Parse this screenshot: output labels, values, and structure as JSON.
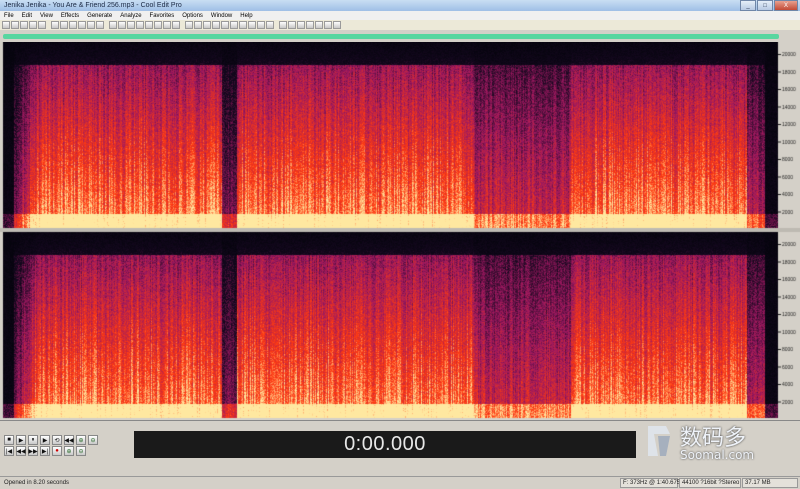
{
  "window": {
    "title": "Jenika Jenika - You Are & Friend 256.mp3 - Cool Edit Pro",
    "minimize": "_",
    "maximize": "□",
    "close": "X"
  },
  "menu": [
    "File",
    "Edit",
    "View",
    "Effects",
    "Generate",
    "Analyze",
    "Favorites",
    "Options",
    "Window",
    "Help"
  ],
  "time_display": "0:00.000",
  "transport": {
    "row1": [
      "■",
      "▶",
      "⏸",
      "▶",
      "⟲",
      "◀◀"
    ],
    "row2": [
      "|◀",
      "◀◀",
      "▶▶",
      "▶|",
      "●"
    ],
    "zoom": [
      "⊕",
      "⊖",
      "⊕",
      "⊖"
    ]
  },
  "logo": {
    "chinese": "数码多",
    "latin": "Soomal.com"
  },
  "status": {
    "left": "Opened in 8.20 seconds",
    "cursor": "F: 373Hz @  1:40.675",
    "format": "44100 ?16bit ?Stereo",
    "size": "37.17 MB"
  },
  "colors": {
    "spectrogram_low": "#14081e",
    "spectrogram_mid": "#9c1860",
    "spectrogram_high": "#ff3a10",
    "spectrogram_peak": "#ffe8a0",
    "overview": "#58d6a0"
  }
}
